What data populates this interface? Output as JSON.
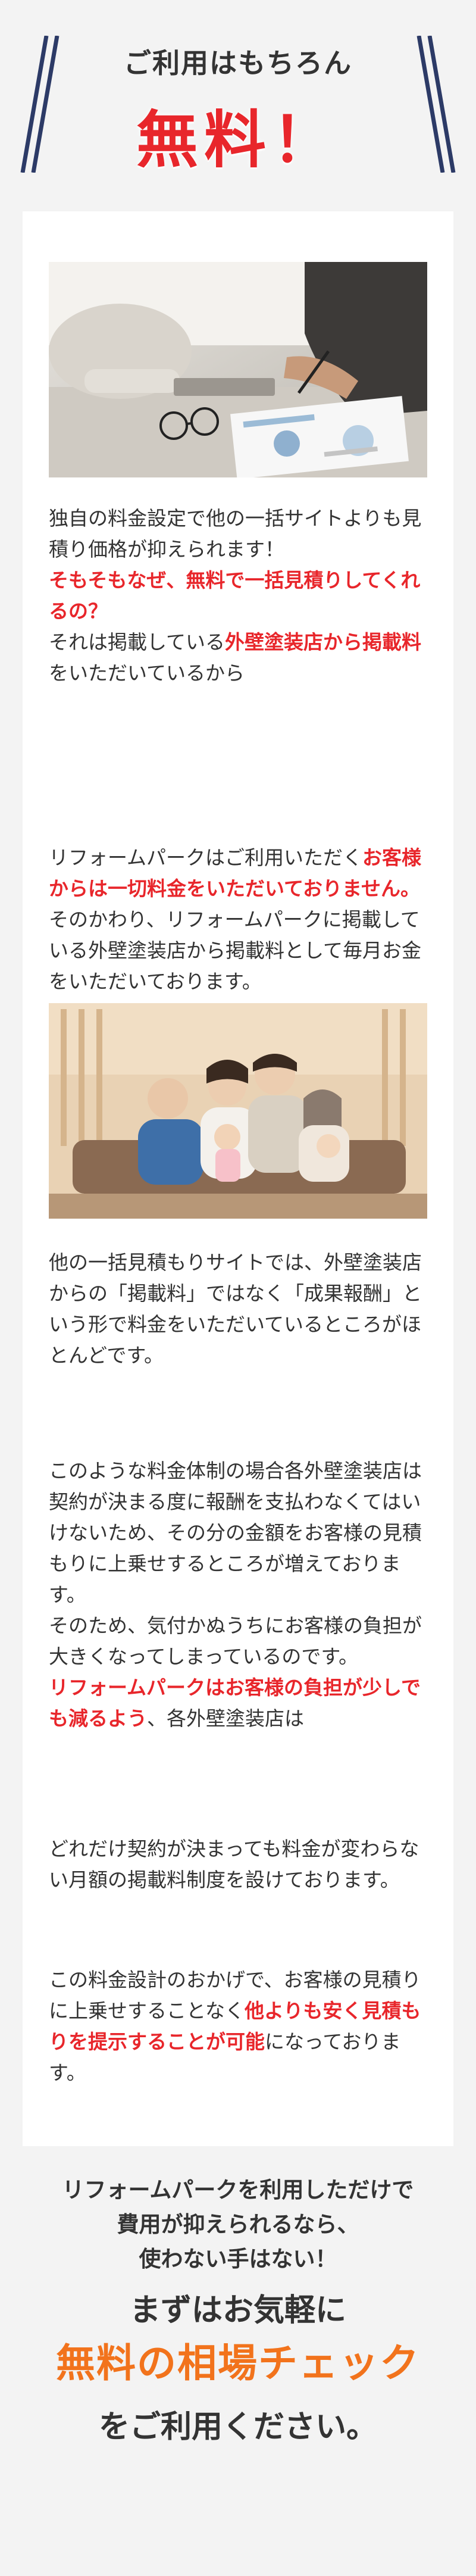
{
  "header": {
    "sub": "ご利用はもちろん",
    "main": "無料！"
  },
  "colors": {
    "accent_red": "#e8262b",
    "accent_orange": "#f2731c",
    "navy_slash": "#2c3a66"
  },
  "images": {
    "photo1_icon": "business-meeting-photo",
    "photo2_icon": "family-on-sofa-photo"
  },
  "block1": {
    "p1": "独自の料金設定で他の一括サイトよりも見積り価格が抑えられます！",
    "p2_red": "そもそもなぜ、無料で一括見積りしてくれるの？",
    "p3_a": "それは掲載している",
    "p3_red": "外壁塗装店から掲載料",
    "p3_b": "をいただいているから"
  },
  "block2": {
    "p1_a": "リフォームパークはご利用いただく",
    "p1_red": "お客様からは一切料金をいただいておりません。",
    "p2": "そのかわり、リフォームパークに掲載している外壁塗装店から掲載料として毎月お金をいただいております。"
  },
  "block3": {
    "p1": "他の一括見積もりサイトでは、外壁塗装店からの「掲載料」ではなく「成果報酬」という形で料金をいただいているところがほとんどです。"
  },
  "block4": {
    "p1": "このような料金体制の場合各外壁塗装店は契約が決まる度に報酬を支払わなくてはいけないため、その分の金額をお客様の見積もりに上乗せするところが増えております。",
    "p2": "そのため、気付かぬうちにお客様の負担が大きくなってしまっているのです。",
    "p3_red": "リフォームパークはお客様の負担が少しでも減るよう",
    "p3_b": "、各外壁塗装店は"
  },
  "block5": {
    "p1": "どれだけ契約が決まっても料金が変わらない月額の掲載料制度を設けております。"
  },
  "block6": {
    "p1_a": "この料金設計のおかげで、お客様の見積りに上乗せすることなく",
    "p1_red": "他よりも安く見積もりを提示することが可能",
    "p1_b": "になっております。"
  },
  "cta": {
    "line1": "リフォームパークを利用しただけで",
    "line2": "費用が抑えられるなら、",
    "line3": "使わない手はない！",
    "line4": "まずはお気軽に",
    "line5": "無料の相場チェック",
    "line6": "をご利用ください。"
  }
}
